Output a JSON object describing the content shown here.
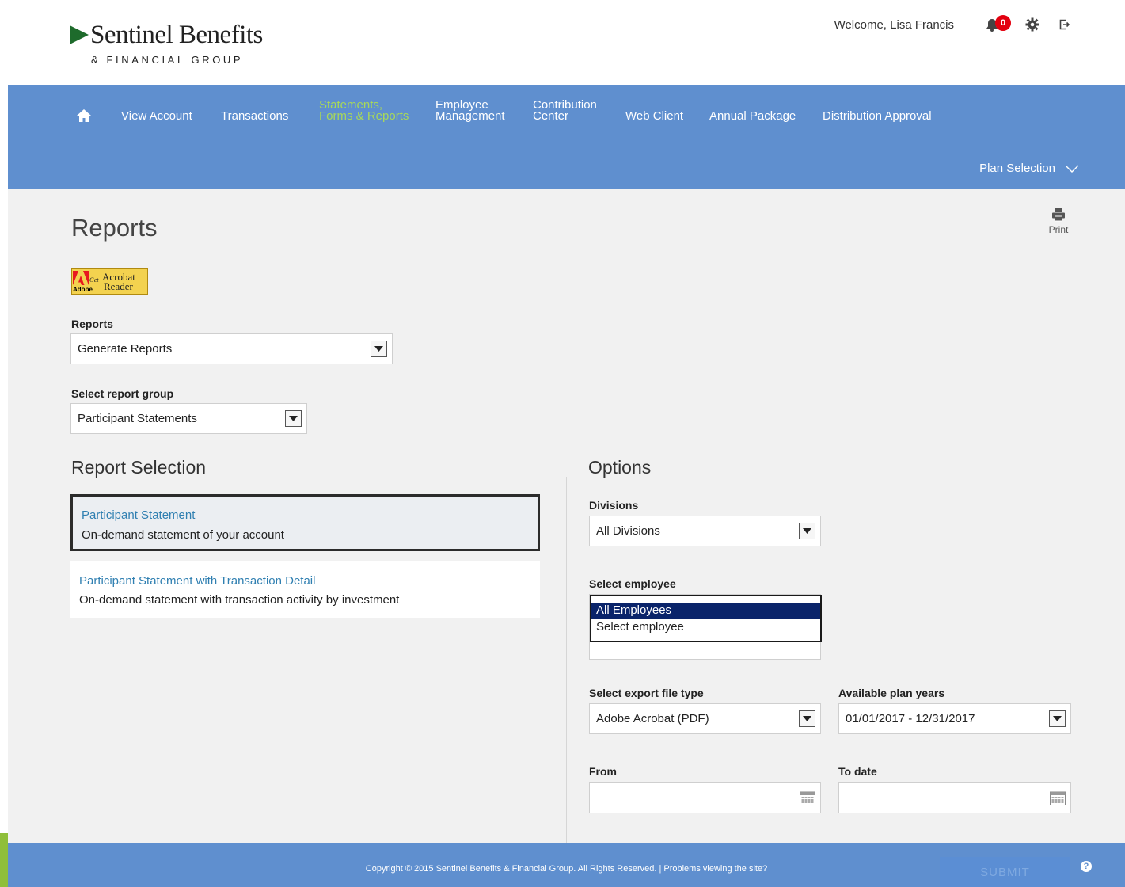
{
  "header": {
    "logo_name": "Sentinel Benefits",
    "logo_sub": "& FINANCIAL GROUP",
    "welcome": "Welcome,  Lisa Francis",
    "notification_count": "0"
  },
  "nav": {
    "items": [
      {
        "label_line1": "View Account",
        "label_line2": ""
      },
      {
        "label_line1": "Transactions",
        "label_line2": ""
      },
      {
        "label_line1": "Statements,",
        "label_line2": "Forms & Reports"
      },
      {
        "label_line1": "Employee",
        "label_line2": "Management"
      },
      {
        "label_line1": "Contribution",
        "label_line2": "Center"
      },
      {
        "label_line1": "Web Client",
        "label_line2": ""
      },
      {
        "label_line1": "Annual Package",
        "label_line2": ""
      },
      {
        "label_line1": "Distribution Approval",
        "label_line2": ""
      }
    ],
    "plan_selection": "Plan Selection",
    "active_color": "#a8d85a",
    "bar_color": "#5f8fcf"
  },
  "page": {
    "title": "Reports",
    "print_label": "Print",
    "acrobat": {
      "adobe": "Adobe",
      "get": "Get",
      "line1": "Acrobat",
      "line2": "Reader"
    }
  },
  "form": {
    "reports_label": "Reports",
    "reports_value": "Generate Reports",
    "report_group_label": "Select report group",
    "report_group_value": "Participant Statements"
  },
  "report_selection": {
    "heading": "Report Selection",
    "items": [
      {
        "title": "Participant Statement",
        "description": "On-demand statement of your account"
      },
      {
        "title": "Participant Statement with Transaction Detail",
        "description": "On-demand statement with transaction activity by investment"
      }
    ]
  },
  "options": {
    "heading": "Options",
    "divisions_label": "Divisions",
    "divisions_value": "All Divisions",
    "employee_label": "Select employee",
    "employee_options": [
      "All Employees",
      "Select employee"
    ],
    "export_label": "Select export file type",
    "export_value": "Adobe Acrobat (PDF)",
    "plan_years_label": "Available plan years",
    "plan_years_value": "01/01/2017 - 12/31/2017",
    "from_label": "From",
    "to_label": "To date"
  },
  "footer": {
    "copyright": "Copyright © 2015 Sentinel Benefits & Financial Group. All Rights Reserved. | Problems viewing the site?",
    "submit": "SUBMIT",
    "help": "?"
  }
}
